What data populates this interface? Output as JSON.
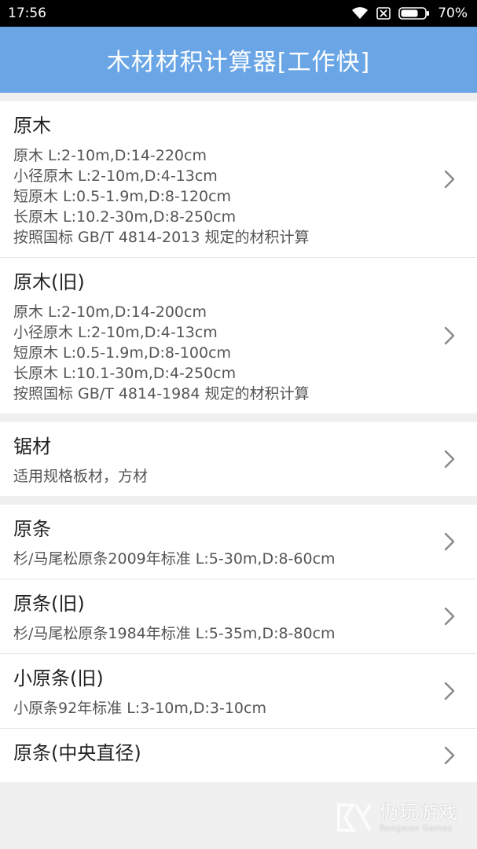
{
  "status": {
    "time": "17:56",
    "battery": "70%"
  },
  "app": {
    "title": "木材材积计算器[工作快]"
  },
  "groups": [
    {
      "items": [
        {
          "title": "原木",
          "lines": [
            "原木 L:2-10m,D:14-220cm",
            "小径原木 L:2-10m,D:4-13cm",
            "短原木 L:0.5-1.9m,D:8-120cm",
            "长原木 L:10.2-30m,D:8-250cm",
            "按照国标 GB/T 4814-2013 规定的材积计算"
          ]
        },
        {
          "title": "原木(旧)",
          "lines": [
            "原木 L:2-10m,D:14-200cm",
            "小径原木 L:2-10m,D:4-13cm",
            "短原木 L:0.5-1.9m,D:8-100cm",
            "长原木 L:10.1-30m,D:4-250cm",
            "按照国标 GB/T 4814-1984 规定的材积计算"
          ]
        }
      ]
    },
    {
      "items": [
        {
          "title": "锯材",
          "lines": [
            "适用规格板材，方材"
          ]
        }
      ]
    },
    {
      "items": [
        {
          "title": "原条",
          "lines": [
            "杉/马尾松原条2009年标准 L:5-30m,D:8-60cm"
          ]
        },
        {
          "title": "原条(旧)",
          "lines": [
            "杉/马尾松原条1984年标准 L:5-35m,D:8-80cm"
          ]
        },
        {
          "title": "小原条(旧)",
          "lines": [
            "小原条92年标准 L:3-10m,D:3-10cm"
          ]
        },
        {
          "title": "原条(中央直径)",
          "lines": []
        }
      ]
    }
  ],
  "watermark": {
    "main": "仍玩游戏",
    "sub": "Rengwan Games"
  },
  "colors": {
    "app_bar": "#6aa6e6",
    "background": "#f0f0f0"
  }
}
